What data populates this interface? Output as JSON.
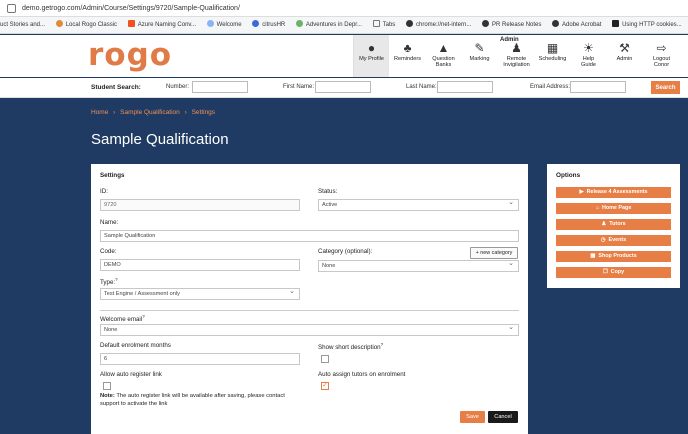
{
  "browser": {
    "url": "demo.getrogo.com/Admin/Course/Settings/9720/Sample-Qualification/",
    "bookmarks": [
      "uct Stories and...",
      "Local Rogo Classic",
      "Azure Naming Conv...",
      "Welcome",
      "citrusHR",
      "Adventures in Depr...",
      "Tabs",
      "chrome://net-intern...",
      "PR Release Notes",
      "Adobe Acrobat",
      "Using HTTP cookies..."
    ]
  },
  "header": {
    "logo": "rogo",
    "admin_label": "Admin",
    "nav": [
      {
        "label": "My Profile",
        "icon": "person-icon"
      },
      {
        "label": "Reminders",
        "icon": "bell-icon"
      },
      {
        "label": "Question Banks",
        "icon": "speech-bubble-icon"
      },
      {
        "label": "Marking",
        "icon": "edit-icon"
      },
      {
        "label": "Remote Invigilation",
        "icon": "invigilator-icon"
      },
      {
        "label": "Scheduling",
        "icon": "calendar-icon"
      },
      {
        "label": "Help Guide",
        "icon": "bulb-icon"
      },
      {
        "label": "Admin",
        "icon": "wrench-icon"
      },
      {
        "label": "Logout Conor",
        "icon": "logout-icon"
      }
    ]
  },
  "student_search": {
    "title": "Student Search:",
    "number_label": "Number:",
    "first_name_label": "First Name:",
    "last_name_label": "Last Name:",
    "email_label": "Email Address:",
    "button": "Search"
  },
  "breadcrumb": [
    "Home",
    "›",
    "Sample Qualification",
    "›",
    "Settings"
  ],
  "page_title": "Sample Qualification",
  "settings": {
    "heading": "Settings",
    "id_label": "ID:",
    "id_value": "9720",
    "status_label": "Status:",
    "status_value": "Active",
    "name_label": "Name:",
    "name_value": "Sample Qualification",
    "code_label": "Code:",
    "code_value": "DEMO",
    "category_label": "Category (optional):",
    "new_category": "+ new category",
    "category_value": "None",
    "type_label": "Type:",
    "type_sup": "?",
    "type_value": "Test Engine / Assessment only",
    "welcome_label": "Welcome email",
    "welcome_sup": "?",
    "welcome_value": "None",
    "enrolment_label": "Default enrolment months",
    "enrolment_value": "6",
    "short_desc_label": "Show short description",
    "short_desc_sup": "?",
    "short_desc_checked": false,
    "auto_register_label": "Allow auto register link",
    "auto_register_checked": false,
    "auto_assign_label": "Auto assign tutors on enrolment",
    "auto_assign_checked": true,
    "note_bold": "Note:",
    "note_text": "The auto register link will be available after saving, please contact",
    "note_text2": "support to activate the link",
    "save": "Save",
    "cancel": "Cancel"
  },
  "options": {
    "title": "Options",
    "buttons": [
      {
        "label": "Release 4 Assessments",
        "icon": "release-icon"
      },
      {
        "label": "Home Page",
        "icon": "home-icon"
      },
      {
        "label": "Tutors",
        "icon": "user-icon"
      },
      {
        "label": "Events",
        "icon": "clock-icon"
      },
      {
        "label": "Shop Products",
        "icon": "cart-icon"
      },
      {
        "label": "Copy",
        "icon": "copy-icon"
      }
    ]
  },
  "colors": {
    "brand": "#e67e45",
    "background": "#1f3b63",
    "link": "#f08f55"
  }
}
